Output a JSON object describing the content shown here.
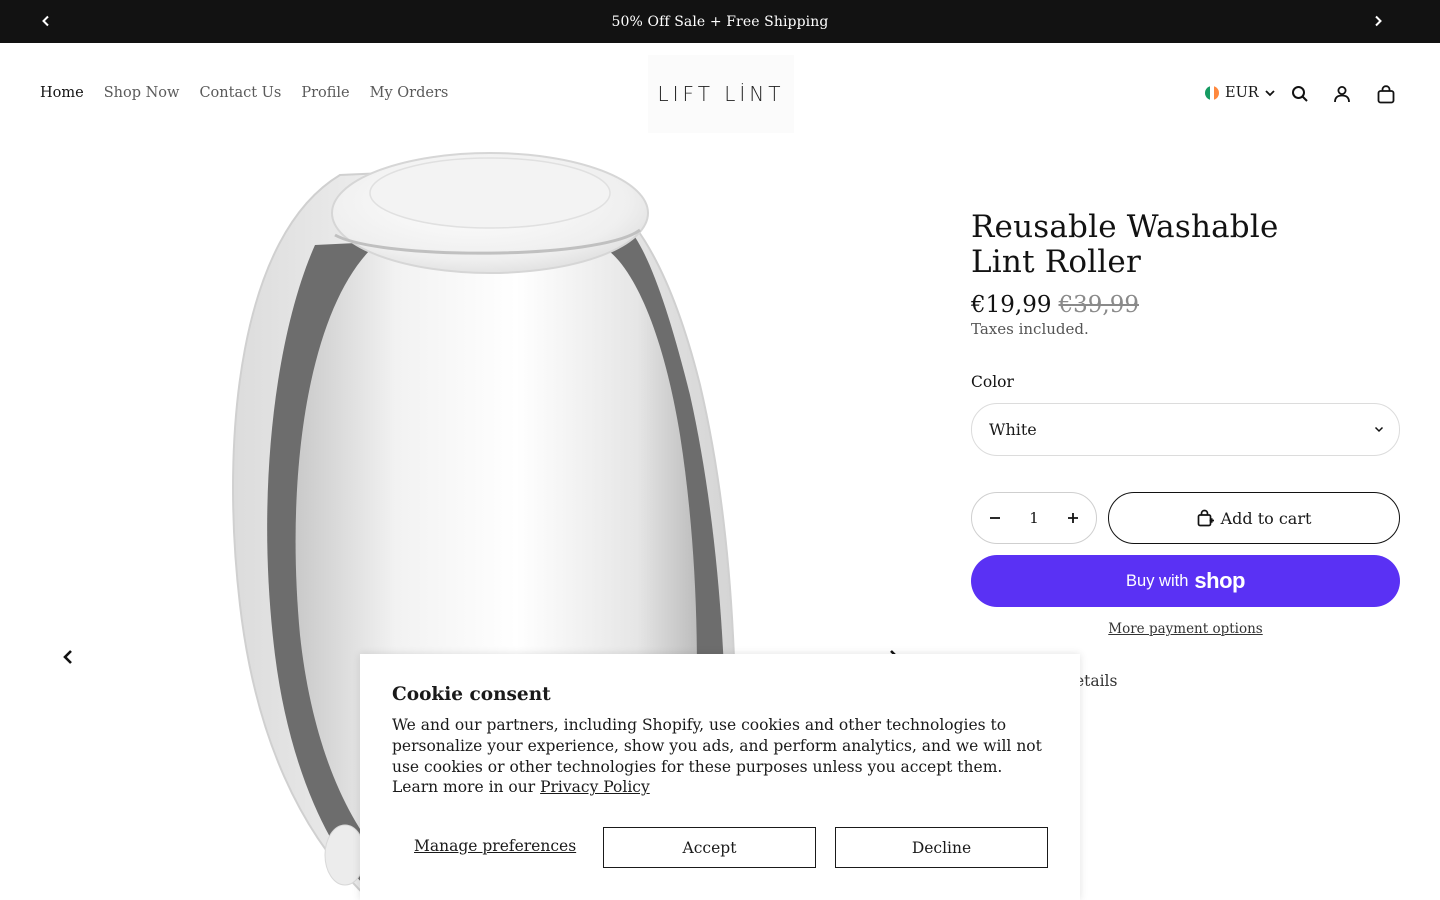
{
  "announcement": {
    "text": "50% Off Sale + Free Shipping",
    "prev_icon": "chevron-left-icon",
    "next_icon": "chevron-right-icon"
  },
  "nav": {
    "items": [
      {
        "label": "Home",
        "active": true
      },
      {
        "label": "Shop Now"
      },
      {
        "label": "Contact Us"
      },
      {
        "label": "Profile"
      },
      {
        "label": "My Orders"
      }
    ]
  },
  "logo": {
    "text": "LIFT LİNT"
  },
  "currency": {
    "code": "EUR",
    "flag_colors": [
      "#169b62",
      "#ffffff",
      "#ff883e"
    ]
  },
  "header_icons": [
    "search-icon",
    "account-icon",
    "cart-icon"
  ],
  "product": {
    "title_line1": "Reusable Washable",
    "title_line2": "Lint Roller",
    "price": "€19,99",
    "compare_price": "€39,99",
    "taxes_note": "Taxes included.",
    "color_label": "Color",
    "color_value": "White",
    "quantity": "1",
    "add_to_cart": "Add to cart",
    "buy_with": "Buy with",
    "shop_brand": "shop",
    "more_payment": "More payment options",
    "details_partial": "letails"
  },
  "cookie": {
    "title": "Cookie consent",
    "body": "We and our partners, including Shopify, use cookies and other technologies to personalize your experience, show you ads, and perform analytics, and we will not use cookies or other technologies for these purposes unless you accept them. Learn more in our ",
    "privacy_link": "Privacy Policy",
    "manage": "Manage preferences",
    "accept": "Accept",
    "decline": "Decline"
  },
  "colors": {
    "announcement_bg": "#121212",
    "shop_pay": "#5a31f4"
  }
}
